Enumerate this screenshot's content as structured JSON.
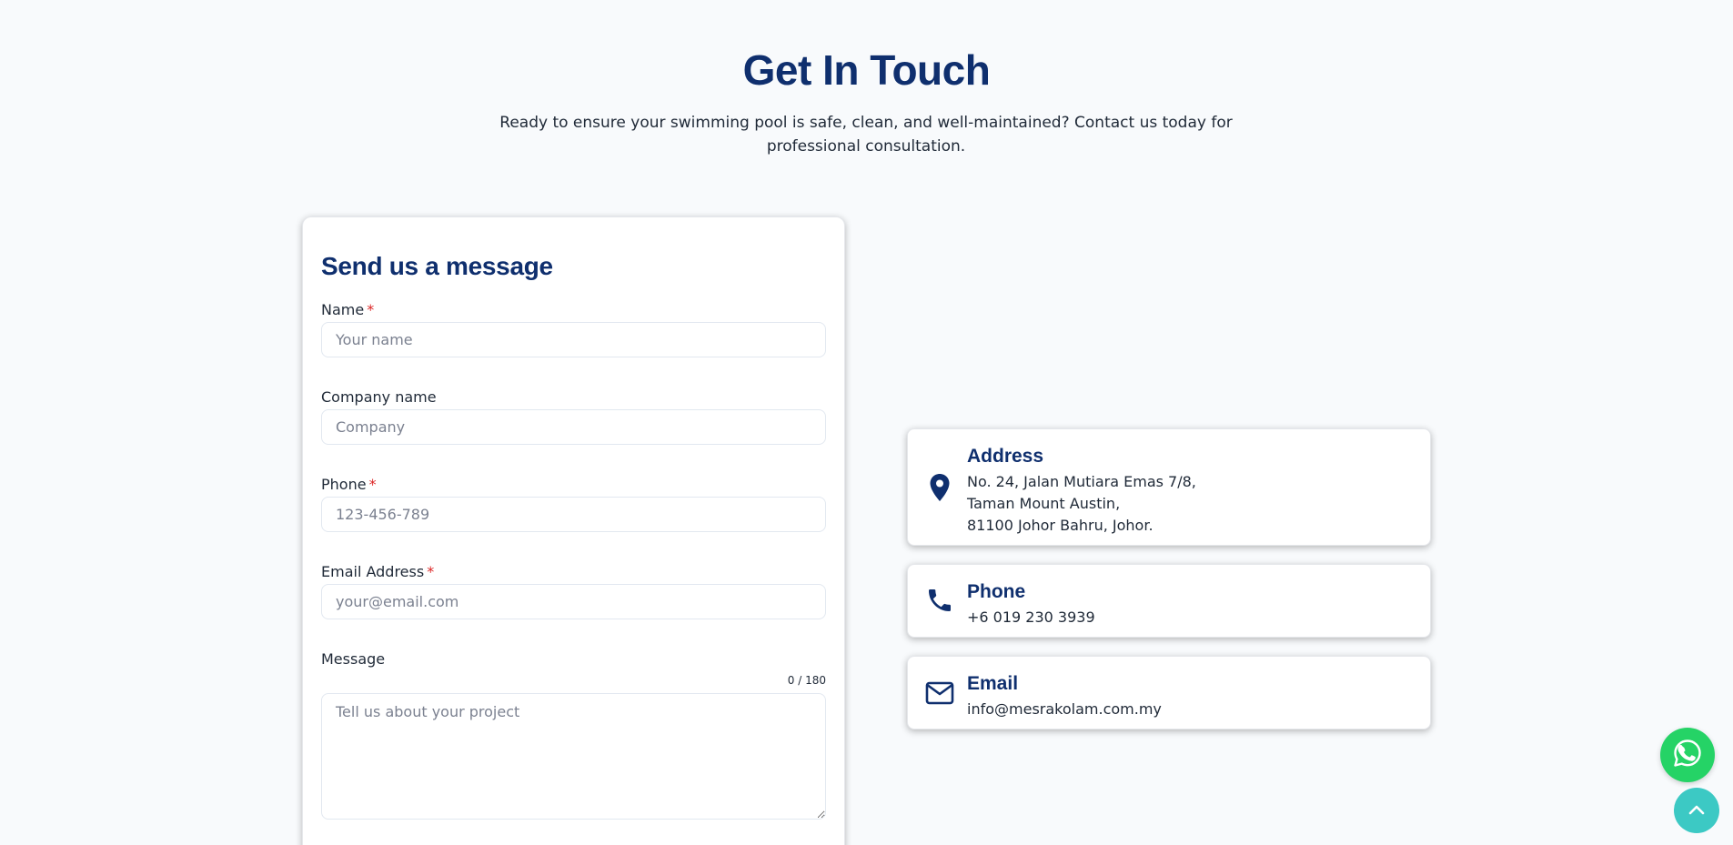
{
  "section": {
    "title": "Get In Touch",
    "subtitle": "Ready to ensure your swimming pool is safe, clean, and well-maintained? Contact us today for professional consultation."
  },
  "form": {
    "title": "Send us a message",
    "fields": [
      {
        "label": "Name",
        "required": true,
        "placeholder": "Your name",
        "value": ""
      },
      {
        "label": "Company name",
        "required": false,
        "placeholder": "Company",
        "value": ""
      },
      {
        "label": "Phone",
        "required": true,
        "placeholder": "123-456-789",
        "value": ""
      },
      {
        "label": "Email Address",
        "required": true,
        "placeholder": "your@email.com",
        "value": ""
      }
    ],
    "required_marker": "*",
    "message": {
      "label": "Message",
      "placeholder": "Tell us about your project",
      "counter": "0 / 180"
    }
  },
  "contact": {
    "address": {
      "title": "Address",
      "icon": "map-pin-icon",
      "lines": [
        "No. 24, Jalan Mutiara Emas 7/8,",
        "Taman Mount Austin,",
        "81100 Johor Bahru, Johor."
      ]
    },
    "phone": {
      "title": "Phone",
      "icon": "phone-icon",
      "value": "+6 019 230 3939"
    },
    "email": {
      "title": "Email",
      "icon": "envelope-icon",
      "value": "info@mesrakolam.com.my"
    }
  },
  "floating": {
    "whatsapp_icon": "whatsapp-icon",
    "back_to_top_icon": "chevron-up-icon"
  },
  "colors": {
    "brand": "#0f2f6e",
    "background": "#f8fafc",
    "required": "#dc2626",
    "whatsapp": "#25d366",
    "back_to_top": "#3cc9c4"
  }
}
